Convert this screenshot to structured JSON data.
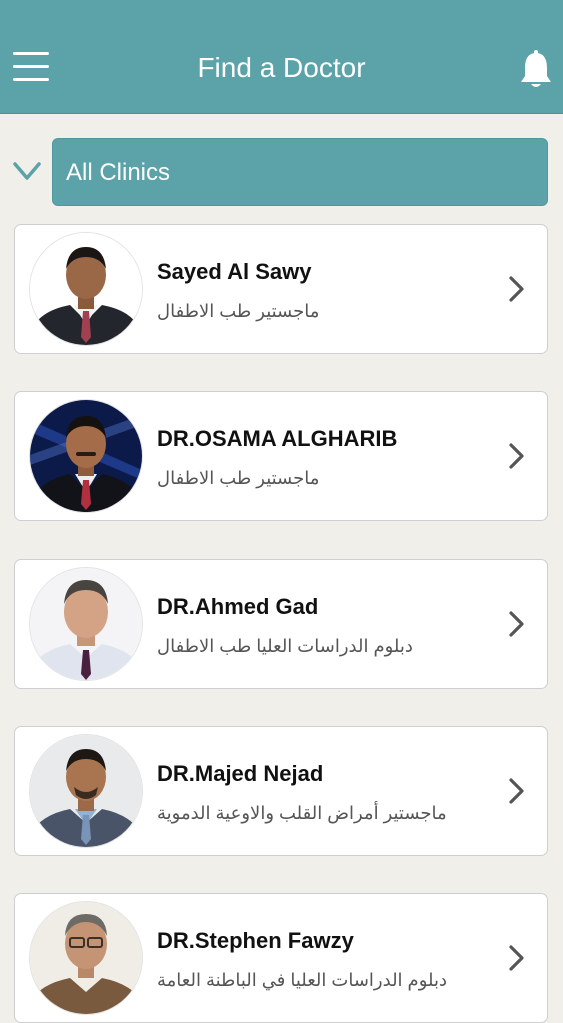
{
  "header": {
    "title": "Find a Doctor",
    "menu_icon": "hamburger-menu-icon",
    "notification_icon": "bell-icon"
  },
  "filter": {
    "selected_clinic": "All Clinics",
    "toggle_icon": "chevron-down-icon"
  },
  "doctors": [
    {
      "name": "Sayed Al Sawy",
      "specialty": "ماجستير طب الاطفال"
    },
    {
      "name": "DR.OSAMA ALGHARIB",
      "specialty": "ماجستير طب الاطفال"
    },
    {
      "name": "DR.Ahmed Gad",
      "specialty": "دبلوم الدراسات العليا طب الاطفال"
    },
    {
      "name": "DR.Majed Nejad",
      "specialty": "ماجستير أمراض القلب والاوعية الدموية"
    },
    {
      "name": "DR.Stephen Fawzy",
      "specialty": "دبلوم الدراسات العليا في الباطنة العامة"
    }
  ],
  "colors": {
    "header": "#5ba3a8",
    "background": "#f1efea",
    "card": "#ffffff"
  }
}
